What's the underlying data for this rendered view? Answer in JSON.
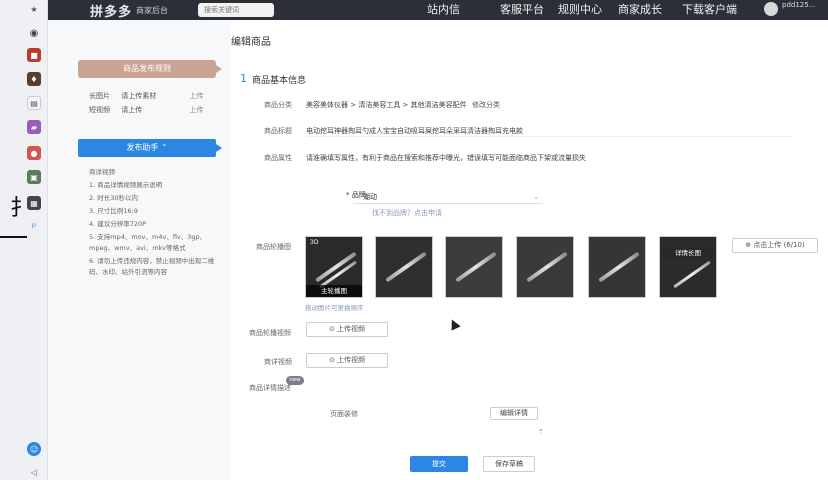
{
  "topbar": {
    "logo": "拼多多",
    "logo_sub": "商家后台",
    "search_placeholder": "搜索关键词",
    "nav": [
      "站内信",
      "客服平台",
      "规则中心",
      "商家成长",
      "下载客户端"
    ],
    "user": "pdd125..."
  },
  "side": {
    "rules_button": "商品发布规则",
    "requirements": [
      {
        "name": "长图片",
        "status": "请上传素材",
        "action": "上传"
      },
      {
        "name": "短视频",
        "status": "请上传",
        "action": "上传"
      }
    ],
    "guide_button": "发布助手 ⌃",
    "guide_items": [
      "商详视频",
      "1. 商品详情视频展示说明",
      "2. 时长30秒以内",
      "3. 尺寸比例16:9",
      "4. 建议分辨率720P",
      "5. 支持mp4、mov、m4v、flv、3gp、mpeg、wmv、avi、mkv等格式",
      "6. 请勿上传违规内容，禁止视频中出现二维码、水印、站外引流等内容"
    ]
  },
  "main": {
    "page_title": "编辑商品",
    "section_num": "1",
    "section_title": "商品基本信息",
    "category_label": "商品分类",
    "category_value": "美容美体仪器 > 清洁美容工具 > 其他清洁美容配件",
    "category_edit": "修改分类",
    "title_label": "商品标题",
    "title_value": "电动挖耳神器掏耳勺成人宝宝自动吸耳屎挖耳朵采耳清洁器掏耳充电款",
    "attr_label": "商品属性",
    "attr_hint": "请准确填写属性，有利于商品在搜索和推荐中曝光，错误填写可能面临商品下架或流量损失",
    "brand_label": "* 品牌",
    "brand_value": "潮动",
    "brand_hint": "找不到品牌？点击申请",
    "main_images_label": "商品轮播图",
    "thumbnails": [
      "主轮播图",
      "",
      "",
      "",
      "",
      "详情长图"
    ],
    "upload_image": "⊕ 点击上传 (6/10)",
    "image_hint": "拖动图片可更换顺序",
    "video_label": "商品轮播视频",
    "video_button": "⊙ 上传视频",
    "detail_video_label": "商详视频",
    "detail_video_button": "⊙ 上传视频",
    "detail_label": "商品详情描述",
    "new_badge": "new",
    "page_design_label": "页面装修",
    "edit_detail": "编辑详情",
    "submit": "提交",
    "save_draft": "保存草稿"
  }
}
